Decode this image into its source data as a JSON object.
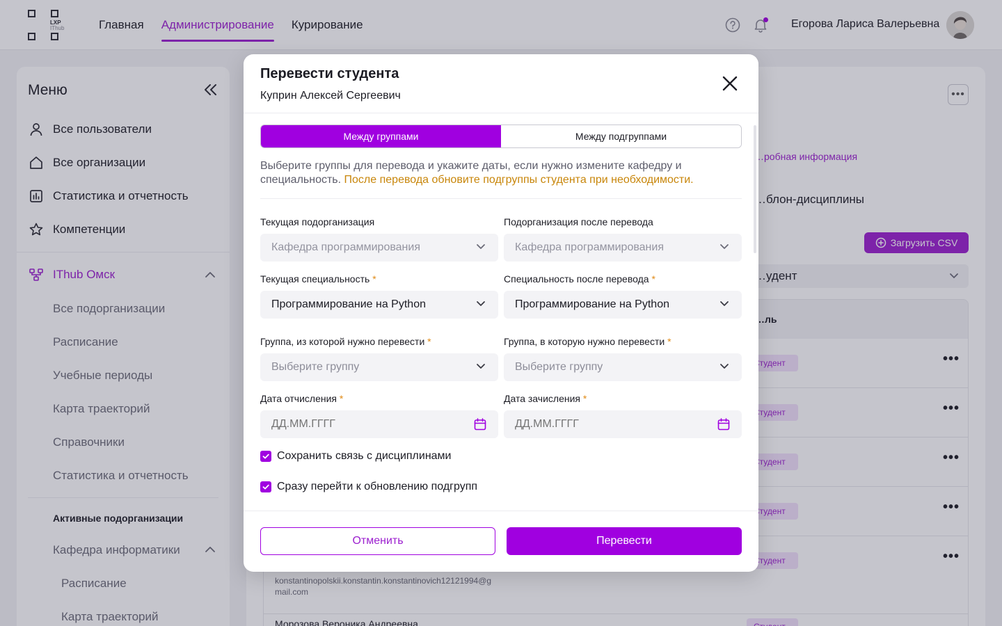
{
  "topbar": {
    "logo_line1": "LXP",
    "logo_line2": "IThub",
    "nav": [
      {
        "label": "Главная",
        "active": false
      },
      {
        "label": "Администрирование",
        "active": true
      },
      {
        "label": "Курирование",
        "active": false
      }
    ],
    "user_name": "Егорова Лариса Валерьевна"
  },
  "sidebar": {
    "title": "Меню",
    "items": [
      {
        "label": "Все пользователи",
        "icon": "user-icon"
      },
      {
        "label": "Все организации",
        "icon": "home-icon"
      },
      {
        "label": "Статистика и отчетность",
        "icon": "chart-icon"
      },
      {
        "label": "Компетенции",
        "icon": "star-icon"
      }
    ],
    "org": {
      "label": "IThub Омск",
      "icon": "org-tree-icon"
    },
    "org_items": [
      "Все подорганизации",
      "Расписание",
      "Учебные периоды",
      "Карта траекторий",
      "Справочники",
      "Статистика и отчетность"
    ],
    "section_title": "Активные подорганизации",
    "dept": "Кафедра информатики",
    "dept_items": [
      "Расписание",
      "Карта траекторий"
    ]
  },
  "background": {
    "link": "…робная информация",
    "tab": "…блон-дисциплины",
    "csv_button": "Загрузить CSV",
    "role_filter": "…удент",
    "column_header": "…ль",
    "badge": "Студент",
    "email": "konstantinopolskii.konstantin.konstantinovich12121994@gmail.com",
    "next_name": "Морозова Вероника Андреевна"
  },
  "modal": {
    "title": "Перевести студента",
    "student": "Куприн Алексей Сергеевич",
    "tabs": [
      {
        "label": "Между группами",
        "active": true
      },
      {
        "label": "Между подгруппами",
        "active": false
      }
    ],
    "description": "Выберите группы для перевода и укажите даты, если нужно измените кафедру и специальность.",
    "warning": "После перевода обновите подгруппы студента при необходимости.",
    "fields": {
      "current_org_label": "Текущая подорганизация",
      "current_org_value": "Кафедра программирования",
      "new_org_label": "Подорганизация после перевода",
      "new_org_value": "Кафедра программирования",
      "current_spec_label": "Текущая специальность",
      "current_spec_value": "Программирование на Python",
      "new_spec_label": "Специальность после перевода",
      "new_spec_value": "Программирование на Python",
      "from_group_label": "Группа, из которой нужно перевести",
      "from_group_placeholder": "Выберите группу",
      "to_group_label": "Группа, в которую нужно перевести",
      "to_group_placeholder": "Выберите группу",
      "expel_date_label": "Дата отчисления",
      "enroll_date_label": "Дата зачисления",
      "date_placeholder": "ДД.ММ.ГГГГ",
      "required_mark": "*"
    },
    "checkboxes": [
      {
        "label": "Сохранить связь с дисциплинами",
        "checked": true
      },
      {
        "label": "Сразу перейти к обновлению подгрупп",
        "checked": true
      }
    ],
    "cancel_label": "Отменить",
    "submit_label": "Перевести"
  },
  "colors": {
    "accent": "#a000e0",
    "warning": "#c8860a",
    "required": "#e08a16"
  }
}
